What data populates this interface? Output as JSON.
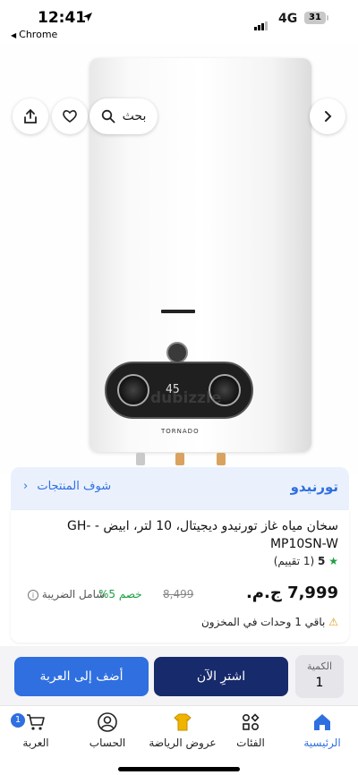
{
  "status": {
    "time": "12:41",
    "back_app": "Chrome",
    "network": "4G",
    "battery": "31"
  },
  "nav": {
    "search_label": "بحث"
  },
  "image": {
    "watermark": "dubizzle",
    "brand_mark": "TORNADO",
    "display": "45"
  },
  "brand": {
    "name": "تورنيدو",
    "see_products": "شوف المنتجات"
  },
  "product": {
    "title": "سخان مياه غاز تورنيدو ديجيتال، 10 لتر، ابيض - GH-MP10SN-W",
    "rating": "5",
    "rating_count": "(1 تقييم)",
    "price": "7,999 ج.م.",
    "old_price": "8,499",
    "discount": "خصم 5%",
    "tax": "شامل الضريبة",
    "stock": "باقي 1 وحدات في المخزون"
  },
  "purchase": {
    "quantity_label": "الكمية",
    "quantity_value": "1",
    "buy_now": "اشترِ الآن",
    "add_to_cart": "أضف إلى العربة"
  },
  "tabs": [
    {
      "label": "الرئيسية",
      "icon": "home-icon",
      "active": true
    },
    {
      "label": "الفئات",
      "icon": "categories-icon"
    },
    {
      "label": "عروض الرياضة",
      "icon": "jersey-icon"
    },
    {
      "label": "الحساب",
      "icon": "account-icon"
    },
    {
      "label": "العربة",
      "icon": "cart-icon",
      "badge": "1"
    }
  ],
  "colors": {
    "accent": "#2f6fe0",
    "dark_button": "#172a6b",
    "success": "#1e9e44"
  }
}
